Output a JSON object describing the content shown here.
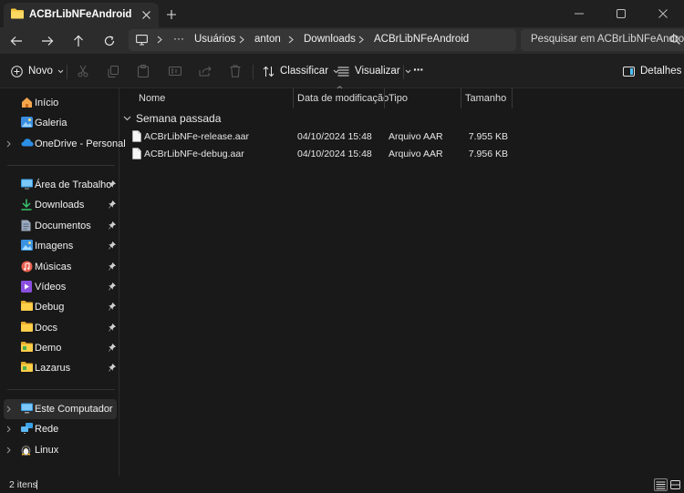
{
  "window": {
    "tab_title": "ACBrLibNFeAndroid"
  },
  "addressbar": {
    "overflow": "···",
    "crumbs": [
      "Usuários",
      "anton",
      "Downloads",
      "ACBrLibNFeAndroid"
    ]
  },
  "search": {
    "placeholder": "Pesquisar em ACBrLibNFeAndroid"
  },
  "toolbar": {
    "new_label": "Novo",
    "sort_label": "Classificar",
    "view_label": "Visualizar",
    "more_label": "···",
    "details_label": "Detalhes"
  },
  "sidebar": {
    "top_items": [
      {
        "label": "Início",
        "icon": "home-icon"
      },
      {
        "label": "Galeria",
        "icon": "gallery-icon"
      },
      {
        "label": "OneDrive - Personal",
        "icon": "onedrive-icon"
      }
    ],
    "pinned_items": [
      {
        "label": "Área de Trabalho",
        "icon": "desktop-icon"
      },
      {
        "label": "Downloads",
        "icon": "download-icon"
      },
      {
        "label": "Documentos",
        "icon": "documents-icon"
      },
      {
        "label": "Imagens",
        "icon": "pictures-icon"
      },
      {
        "label": "Músicas",
        "icon": "music-icon"
      },
      {
        "label": "Vídeos",
        "icon": "videos-icon"
      },
      {
        "label": "Debug",
        "icon": "folder-icon"
      },
      {
        "label": "Docs",
        "icon": "folder-icon"
      },
      {
        "label": "Demo",
        "icon": "folder-icon"
      },
      {
        "label": "Lazarus",
        "icon": "folder-icon"
      }
    ],
    "bottom_items": [
      {
        "label": "Este Computador",
        "icon": "computer-icon"
      },
      {
        "label": "Rede",
        "icon": "network-icon"
      },
      {
        "label": "Linux",
        "icon": "linux-icon"
      }
    ]
  },
  "columns": {
    "name": "Nome",
    "date": "Data de modificação",
    "type": "Tipo",
    "size": "Tamanho"
  },
  "group": {
    "label": "Semana passada"
  },
  "files": [
    {
      "name": "ACBrLibNFe-release.aar",
      "date": "04/10/2024 15:48",
      "type": "Arquivo AAR",
      "size": "7.955 KB"
    },
    {
      "name": "ACBrLibNFe-debug.aar",
      "date": "04/10/2024 15:48",
      "type": "Arquivo AAR",
      "size": "7.956 KB"
    }
  ],
  "status": {
    "item_count": "2 itens"
  },
  "colors": {
    "folder": "#f4c53c",
    "accent": "#4cc2ff"
  }
}
